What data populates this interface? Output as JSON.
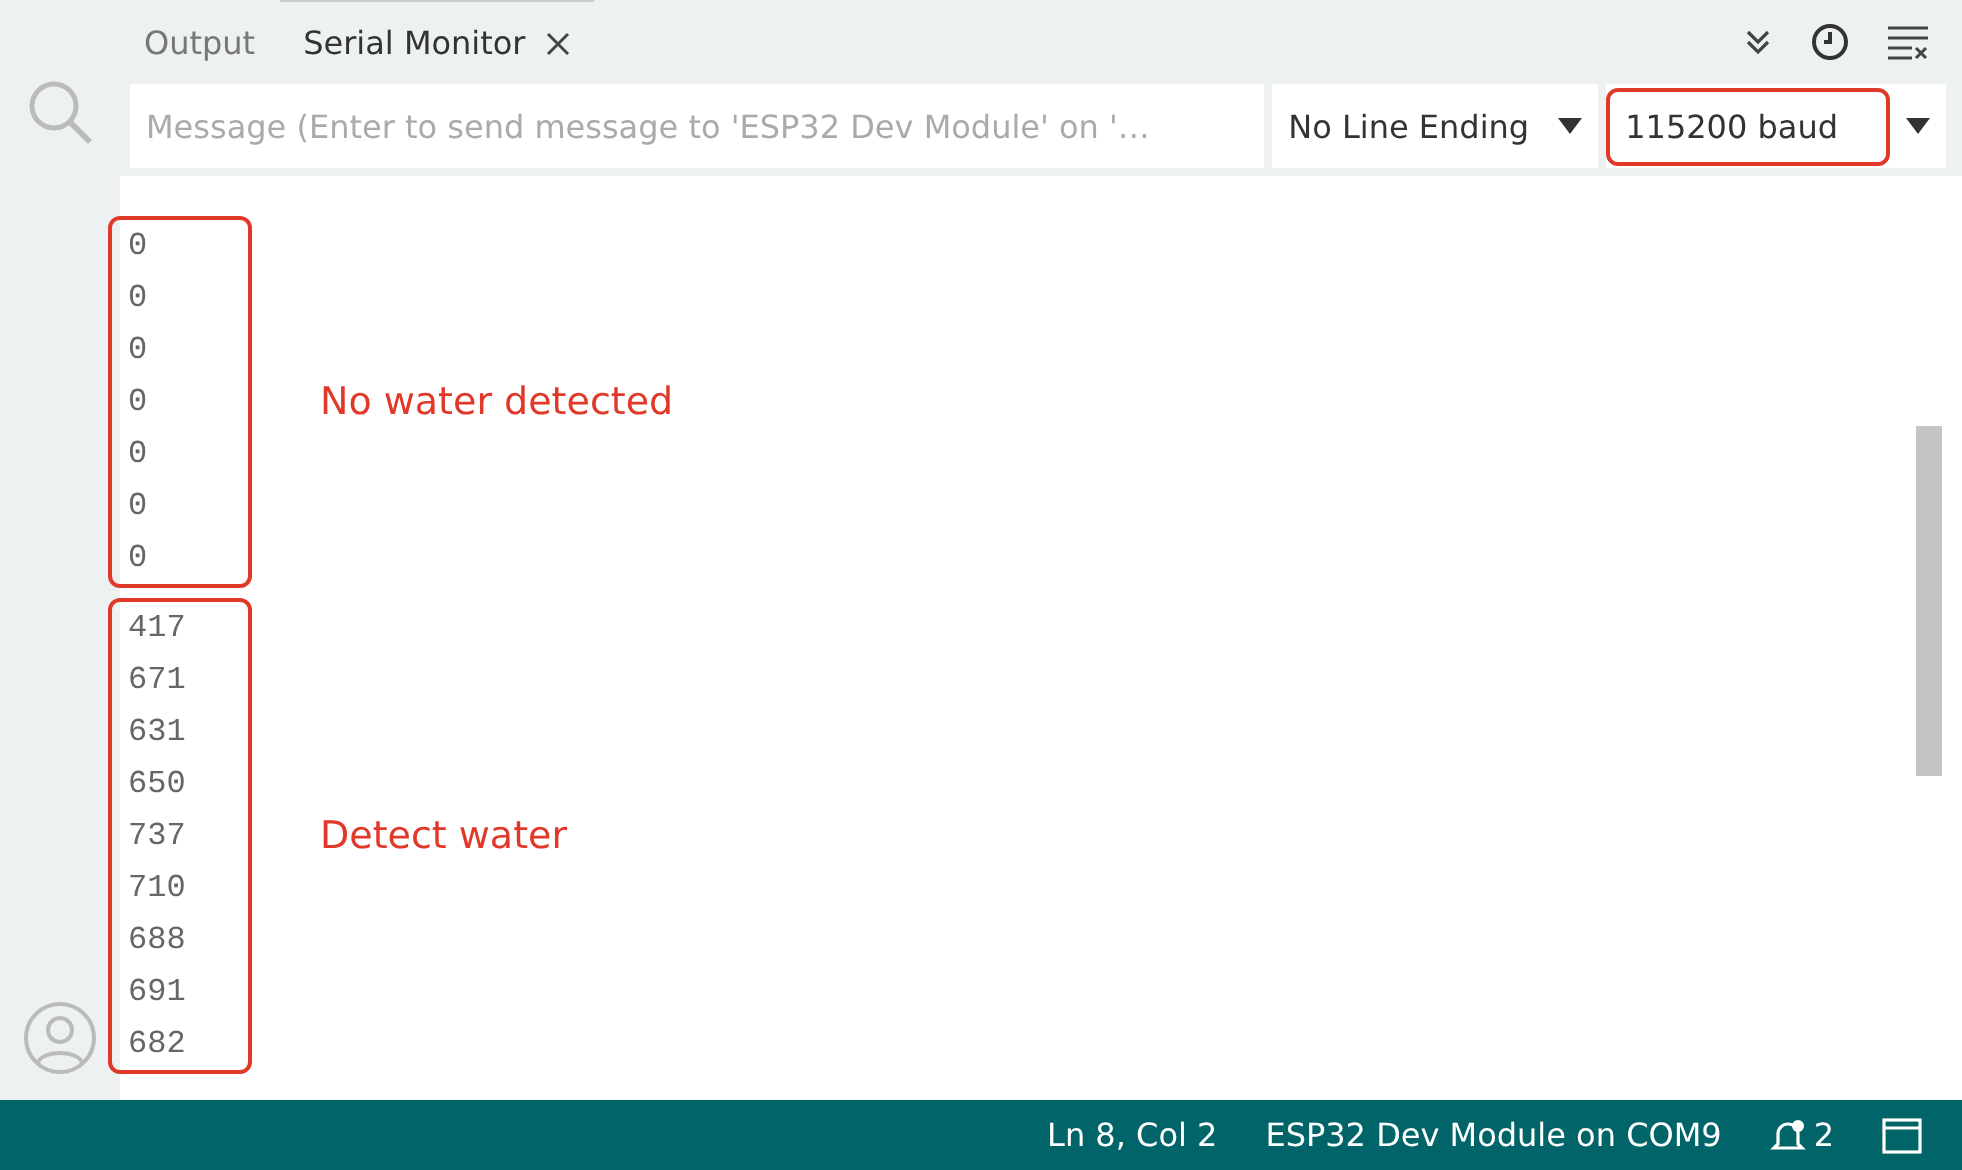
{
  "tabs": [
    {
      "label": "Output",
      "selected": false
    },
    {
      "label": "Serial Monitor",
      "selected": true,
      "closable": true
    }
  ],
  "toolbar": {
    "message": {
      "placeholder": "Message (Enter to send message to 'ESP32 Dev Module' on '…"
    },
    "line_ending": "No Line Ending",
    "baud": "115200 baud"
  },
  "output": {
    "groups": [
      {
        "label": "No water detected",
        "lines": [
          "0",
          "0",
          "0",
          "0",
          "0",
          "0",
          "0"
        ]
      },
      {
        "label": "Detect water",
        "lines": [
          "417",
          "671",
          "631",
          "650",
          "737",
          "710",
          "688",
          "691",
          "682"
        ]
      }
    ]
  },
  "status_bar": {
    "position": "Ln 8, Col 2",
    "board": "ESP32 Dev Module on COM9",
    "notifications": "2"
  }
}
